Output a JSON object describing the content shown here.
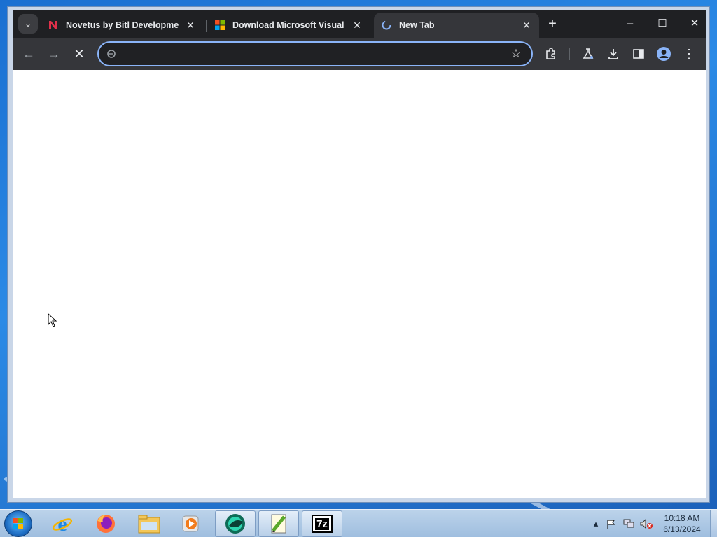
{
  "browser": {
    "tabs": [
      {
        "title": "Novetus by Bitl Development",
        "favicon": "novetus-n-icon",
        "active": false
      },
      {
        "title": "Download Microsoft Visual C++",
        "favicon": "microsoft-logo-icon",
        "active": false
      },
      {
        "title": "New Tab",
        "favicon": "loading-spinner-icon",
        "active": true
      }
    ],
    "address_bar": {
      "value": "",
      "placeholder": ""
    },
    "window_controls": {
      "minimize": "–",
      "maximize": "☐",
      "close": "✕"
    },
    "accent": "#8ab4f8"
  },
  "taskbar": {
    "pinned": [
      {
        "name": "internet-explorer"
      },
      {
        "name": "firefox"
      },
      {
        "name": "windows-explorer"
      },
      {
        "name": "windows-media-player"
      },
      {
        "name": "chrome-app",
        "open": true
      },
      {
        "name": "notepad-plus-plus",
        "open": true
      },
      {
        "name": "7zip",
        "open": true,
        "label": "7z"
      }
    ],
    "clock": {
      "time": "10:18 AM",
      "date": "6/13/2024"
    }
  }
}
